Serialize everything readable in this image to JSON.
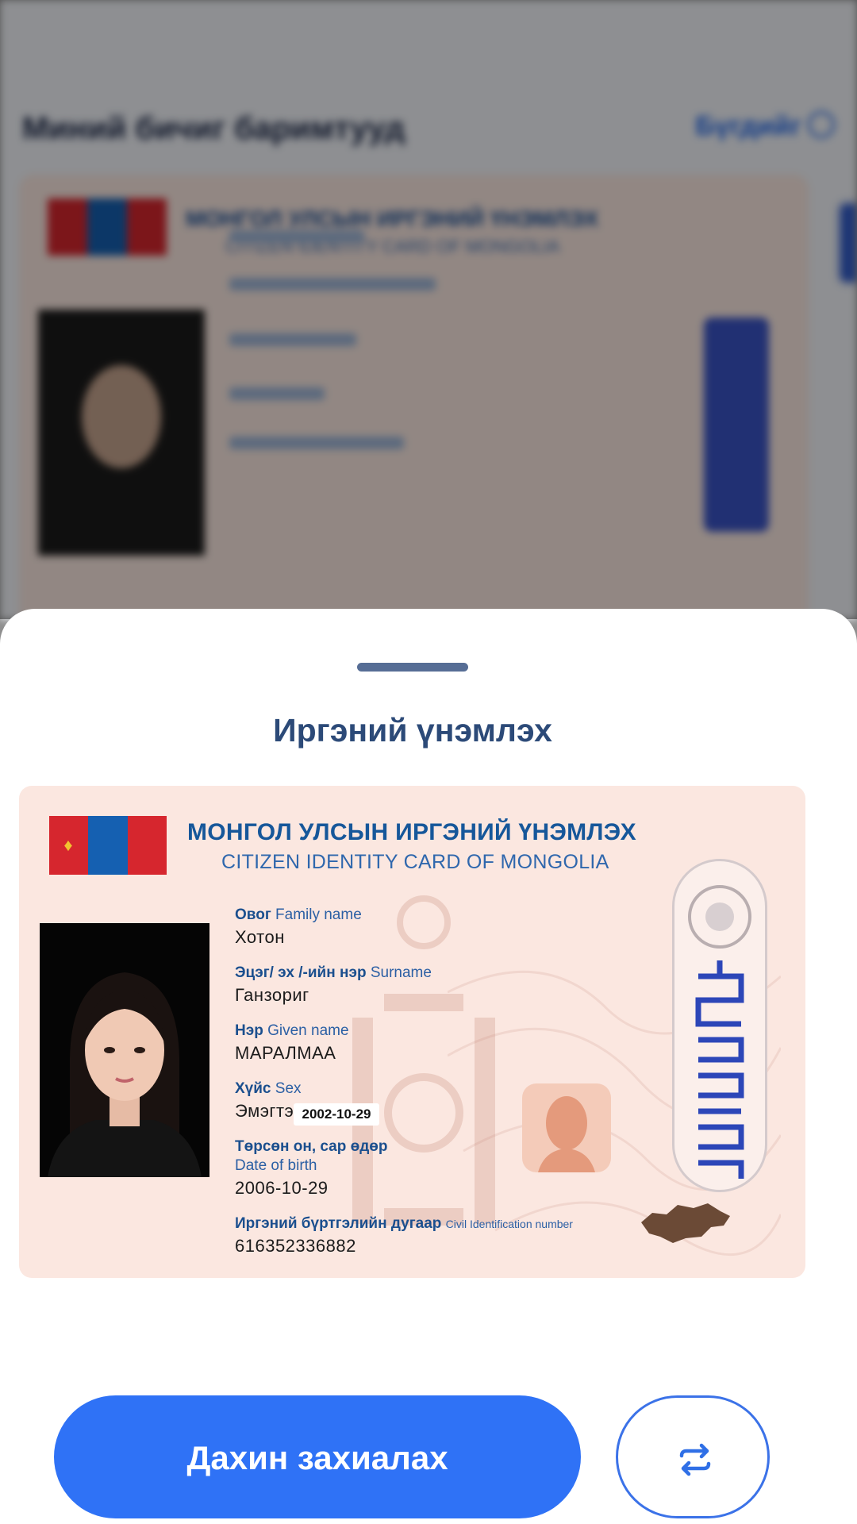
{
  "background": {
    "section_title": "Миний бичиг баримтууд",
    "see_all": "Бүгдийг"
  },
  "sheet": {
    "title": "Иргэний үнэмлэх"
  },
  "card": {
    "title": "МОНГОЛ УЛСЫН ИРГЭНИЙ ҮНЭМЛЭХ",
    "subtitle": "CITIZEN IDENTITY CARD OF MONGOLIA",
    "fields": {
      "family_name": {
        "label_mn": "Овог",
        "label_en": "Family name",
        "value": "Хотон"
      },
      "surname": {
        "label_mn": "Эцэг/ эх /-ийн нэр",
        "label_en": "Surname",
        "value": "Ганзориг"
      },
      "given_name": {
        "label_mn": "Нэр",
        "label_en": "Given name",
        "value": "МАРАЛМАА"
      },
      "sex": {
        "label_mn": "Хүйс",
        "label_en": "Sex",
        "value": "Эмэгтэй"
      },
      "birth": {
        "label_mn": "Төрсөн он, сар өдөр",
        "label_en": "Date of birth",
        "value": "2006-10-29"
      },
      "civil_id": {
        "label_mn": "Иргэний бүртгэлийн дугаар",
        "label_en": "Civil Identification number",
        "value": "616352336882"
      }
    },
    "overlay_date": "2002-10-29"
  },
  "actions": {
    "reorder": "Дахин захиалах",
    "swap_icon": "swap-icon"
  },
  "colors": {
    "primary": "#2f72f6",
    "card_bg": "#fbe7e0",
    "card_title": "#16579a"
  }
}
